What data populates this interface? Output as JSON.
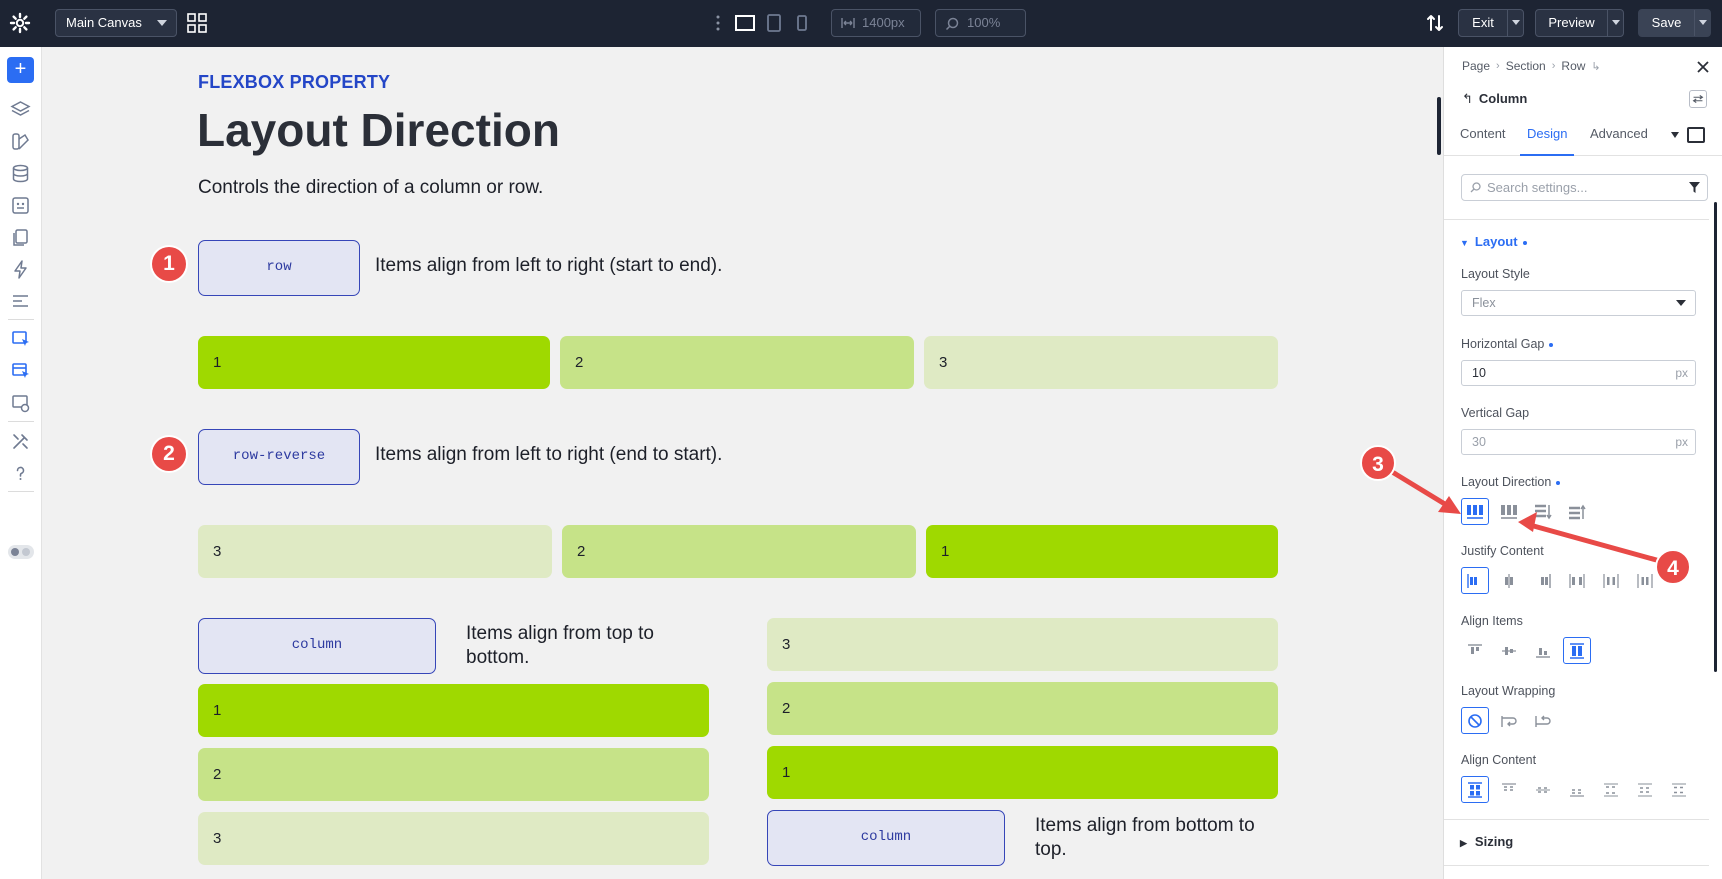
{
  "topbar": {
    "canvas_select": "Main Canvas",
    "width_value": "1400px",
    "zoom_value": "100%",
    "exit_label": "Exit",
    "preview_label": "Preview",
    "save_label": "Save"
  },
  "canvas": {
    "eyebrow": "FLEXBOX PROPERTY",
    "title": "Layout Direction",
    "subtitle": "Controls the direction of a column or row.",
    "examples": [
      {
        "badge": "1",
        "chip": "row",
        "description": "Items align from left to right (start to end).",
        "items": [
          "1",
          "2",
          "3"
        ]
      },
      {
        "badge": "2",
        "chip": "row-reverse",
        "description": "Items align from left to right (end to start).",
        "items": [
          "3",
          "2",
          "1"
        ]
      },
      {
        "chip": "column",
        "description": "Items align from top to bottom.",
        "items": [
          "1",
          "2",
          "3"
        ]
      },
      {
        "chip": "column",
        "description": "Items align from bottom to top.",
        "items": [
          "3",
          "2",
          "1"
        ]
      }
    ],
    "colors": {
      "shade_1": "#9fd900",
      "shade_2": "#c6e388",
      "shade_3": "#dfeac4",
      "accent": "#2446c7"
    }
  },
  "panel": {
    "breadcrumb": [
      "Page",
      "Section",
      "Row"
    ],
    "element_name": "Column",
    "tabs": [
      "Content",
      "Design",
      "Advanced"
    ],
    "active_tab": "Design",
    "search_placeholder": "Search settings...",
    "layout_section": "Layout",
    "layout_style_label": "Layout Style",
    "layout_style_value": "Flex",
    "horizontal_gap_label": "Horizontal Gap",
    "horizontal_gap_value": "10",
    "horizontal_gap_unit": "px",
    "vertical_gap_label": "Vertical Gap",
    "vertical_gap_value": "30",
    "vertical_gap_unit": "px",
    "layout_direction_label": "Layout Direction",
    "justify_content_label": "Justify Content",
    "align_items_label": "Align Items",
    "layout_wrapping_label": "Layout Wrapping",
    "align_content_label": "Align Content",
    "sizing_section": "Sizing",
    "accent": "#2b6df3"
  },
  "annotations": {
    "badge_3": "3",
    "badge_4": "4",
    "color": "#e84a47"
  }
}
